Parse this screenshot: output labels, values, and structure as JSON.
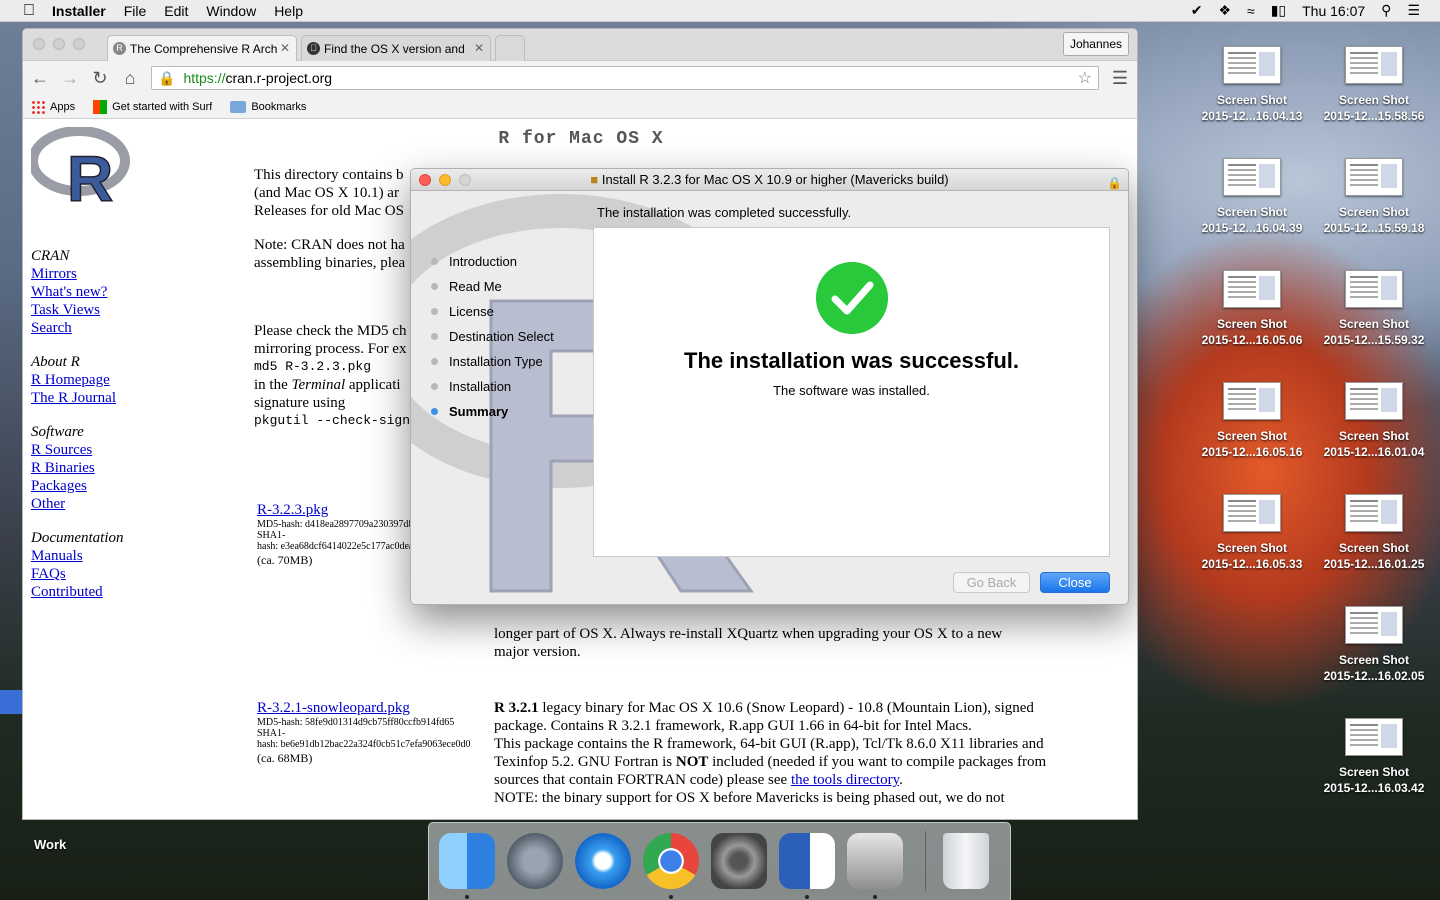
{
  "menubar": {
    "app": "Installer",
    "items": [
      "File",
      "Edit",
      "Window",
      "Help"
    ],
    "clock": "Thu 16:07"
  },
  "browser": {
    "tabs": [
      {
        "label": "The Comprehensive R Arch",
        "favicon": "R"
      },
      {
        "label": "Find the OS X version and"
      }
    ],
    "user": "Johannes",
    "url_scheme": "https://",
    "url_host": "cran.r-project.org",
    "bookmarks": [
      "Apps",
      "Get started with Surf",
      "Bookmarks"
    ]
  },
  "page": {
    "title": "R for Mac OS X",
    "intro1": "This directory contains b",
    "intro2": "(and Mac OS X 10.1) ar",
    "intro3": "Releases for old Mac OS",
    "note1": "Note: CRAN does not ha",
    "note2": "assembling binaries, plea",
    "md5_1": "Please check the MD5 ch",
    "md5_2": "mirroring process. For ex",
    "md5_cmd": "md5 R-3.2.3.pkg",
    "md5_3a": "in the ",
    "md5_3b": "Terminal",
    "md5_3c": " applicati",
    "md5_4": "signature using",
    "pkgutil": "pkgutil --check-sign",
    "sidebar": {
      "cran": "CRAN",
      "cran_links": [
        "Mirrors",
        "What's new?",
        "Task Views",
        "Search"
      ],
      "about": "About R",
      "about_links": [
        "R Homepage",
        "The R Journal"
      ],
      "software": "Software",
      "software_links": [
        "R Sources",
        "R Binaries",
        "Packages",
        "Other"
      ],
      "documentation": "Documentation",
      "doc_links": [
        "Manuals",
        "FAQs",
        "Contributed"
      ]
    },
    "pkg1": {
      "name": "R-3.2.3.pkg",
      "md5": "MD5-hash: d418ea2897709a230397d8",
      "sha1a": "SHA1-",
      "sha1b": "hash: e3ea68dcf6414022e5c177ac0dea",
      "size": "(ca. 70MB)"
    },
    "pkg2": {
      "name": "R-3.2.1-snowleopard.pkg",
      "md5": "MD5-hash: 58fe9d01314d9cb75ff80ccfb914fd65",
      "sha1a": "SHA1-",
      "sha1b": "hash: be6e91db12bac22a324f0cb51c7efa9063ece0d0",
      "size": "(ca. 68MB)"
    },
    "xquartz1": "longer part of OS X. Always re-install XQuartz when upgrading your OS X to a new",
    "xquartz2": "major version.",
    "desc_bold": "R 3.2.1",
    "desc1": " legacy binary for Mac OS X 10.6 (Snow Leopard) - 10.8 (Mountain Lion), signed package. Contains R 3.2.1 framework, R.app GUI 1.66 in 64-bit for Intel Macs.",
    "desc2a": "This package contains the R framework, 64-bit GUI (R.app), Tcl/Tk 8.6.0 X11 libraries and Texinfop 5.2. GNU Fortran is ",
    "desc2_not": "NOT",
    "desc2b": " included (needed if you want to compile packages from sources that contain FORTRAN code) please see ",
    "desc2_link": "the tools directory",
    "desc2c": ".",
    "desc3": "NOTE: the binary support for OS X before Mavericks is being phased out, we do not"
  },
  "installer": {
    "title": "Install R 3.2.3 for Mac OS X 10.9 or higher (Mavericks build)",
    "heading": "The installation was completed successfully.",
    "steps": [
      "Introduction",
      "Read Me",
      "License",
      "Destination Select",
      "Installation Type",
      "Installation",
      "Summary"
    ],
    "current_step": "Summary",
    "success": "The installation was successful.",
    "sub": "The software was installed.",
    "go_back": "Go Back",
    "close": "Close",
    "accent": "#1a74ea",
    "check_color": "#29c93c"
  },
  "desktop": {
    "icons": [
      {
        "name": "Screen Shot",
        "date": "2015-12...16.04.13"
      },
      {
        "name": "Screen Shot",
        "date": "2015-12...15.58.56"
      },
      {
        "name": "Screen Shot",
        "date": "2015-12...16.04.39"
      },
      {
        "name": "Screen Shot",
        "date": "2015-12...15.59.18"
      },
      {
        "name": "Screen Shot",
        "date": "2015-12...16.05.06"
      },
      {
        "name": "Screen Shot",
        "date": "2015-12...15.59.32"
      },
      {
        "name": "Screen Shot",
        "date": "2015-12...16.05.16"
      },
      {
        "name": "Screen Shot",
        "date": "2015-12...16.01.04"
      },
      {
        "name": "Screen Shot",
        "date": "2015-12...16.05.33"
      },
      {
        "name": "Screen Shot",
        "date": "2015-12...16.01.25"
      },
      {
        "name": "Screen Shot",
        "date": "2015-12...16.02.05"
      },
      {
        "name": "Screen Shot",
        "date": "2015-12...16.03.42"
      }
    ],
    "work_label": "Work"
  },
  "dock": {
    "apps": [
      "Finder",
      "Launchpad",
      "Safari",
      "Chrome",
      "System Preferences",
      "Word",
      "Downloads",
      "Trash"
    ]
  }
}
